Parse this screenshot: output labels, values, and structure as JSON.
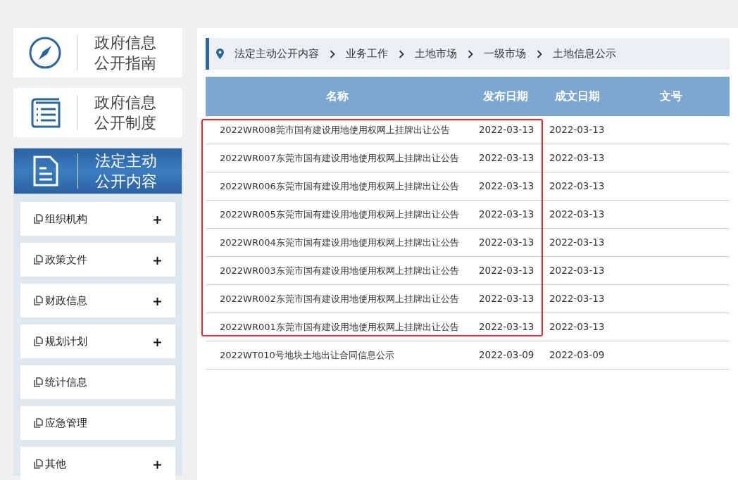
{
  "guide_cards": [
    {
      "title_lines": [
        "政府信息",
        "公开指南"
      ],
      "selected": false
    },
    {
      "title_lines": [
        "政府信息",
        "公开制度"
      ],
      "selected": false
    },
    {
      "title_lines": [
        "法定主动",
        "公开内容"
      ],
      "selected": true
    }
  ],
  "menu": [
    {
      "label": "组织机构",
      "expandable": true
    },
    {
      "label": "政策文件",
      "expandable": true
    },
    {
      "label": "财政信息",
      "expandable": true
    },
    {
      "label": "规划计划",
      "expandable": true
    },
    {
      "label": "统计信息",
      "expandable": false
    },
    {
      "label": "应急管理",
      "expandable": false
    },
    {
      "label": "其他",
      "expandable": true
    }
  ],
  "breadcrumb": [
    "法定主动公开内容",
    "业务工作",
    "土地市场",
    "一级市场",
    "土地信息公示"
  ],
  "table": {
    "columns": [
      "名称",
      "发布日期",
      "成文日期",
      "文号"
    ],
    "rows": [
      {
        "name": "2022WR008莞市国有建设用地使用权网上挂牌出让公告",
        "published": "2022-03-13",
        "written": "2022-03-13",
        "highlighted": true
      },
      {
        "name": "2022WR007东莞市国有建设用地使用权网上挂牌出让公告",
        "published": "2022-03-13",
        "written": "2022-03-13",
        "highlighted": true
      },
      {
        "name": "2022WR006东莞市国有建设用地使用权网上挂牌出让公告",
        "published": "2022-03-13",
        "written": "2022-03-13",
        "highlighted": true
      },
      {
        "name": "2022WR005东莞市国有建设用地使用权网上挂牌出让公告",
        "published": "2022-03-13",
        "written": "2022-03-13",
        "highlighted": true
      },
      {
        "name": "2022WR004东莞市国有建设用地使用权网上挂牌出让公告",
        "published": "2022-03-13",
        "written": "2022-03-13",
        "highlighted": true
      },
      {
        "name": "2022WR003东莞市国有建设用地使用权网上挂牌出让公告",
        "published": "2022-03-13",
        "written": "2022-03-13",
        "highlighted": true
      },
      {
        "name": "2022WR002东莞市国有建设用地使用权网上挂牌出让公告",
        "published": "2022-03-13",
        "written": "2022-03-13",
        "highlighted": true
      },
      {
        "name": "2022WR001东莞市国有建设用地使用权网上挂牌出让公告",
        "published": "2022-03-13",
        "written": "2022-03-13",
        "highlighted": true
      },
      {
        "name": "2022WT010号地块土地出让合同信息公示",
        "published": "2022-03-09",
        "written": "2022-03-09",
        "highlighted": false
      }
    ]
  }
}
